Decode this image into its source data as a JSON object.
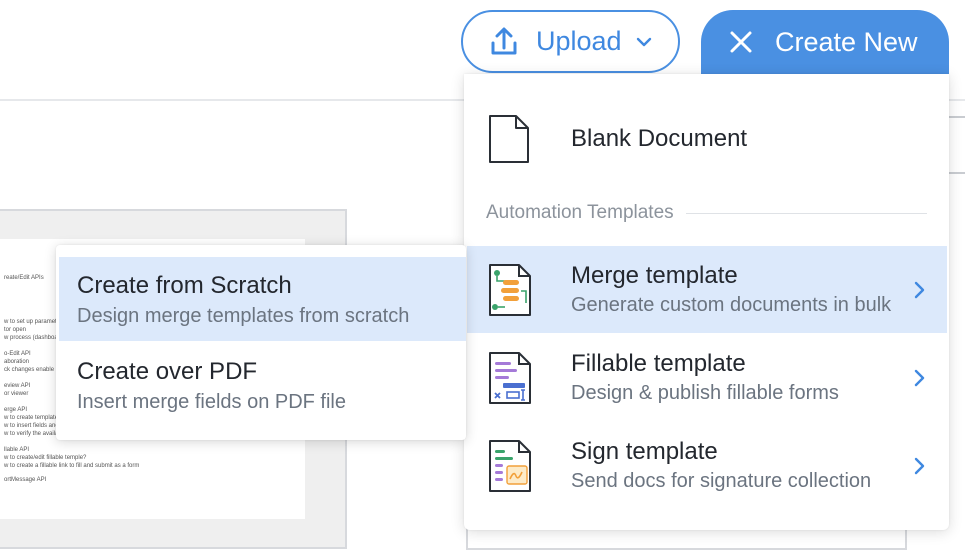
{
  "header": {
    "upload_label": "Upload",
    "create_label": "Create New"
  },
  "document_preview": {
    "lines": [
      "reate/Edit APIs",
      "w to set up parameters",
      "tor open",
      "w process (dashboard)",
      "o-Edit API",
      "aboration",
      "ck changes enable",
      "eview API",
      "or viewer",
      "erge API",
      "w to create template?",
      "w to insert fields and m",
      "w to verify the available",
      "llable API",
      "w to create/edit fillable temple?",
      "w to create a fillable link to fill and submit as a form",
      "ortMessage API"
    ]
  },
  "create_menu": {
    "blank_document": "Blank Document",
    "section_label": "Automation Templates",
    "items": [
      {
        "title": "Merge template",
        "subtitle": "Generate custom documents in bulk"
      },
      {
        "title": "Fillable template",
        "subtitle": "Design & publish fillable forms"
      },
      {
        "title": "Sign template",
        "subtitle": "Send docs for signature collection"
      }
    ]
  },
  "merge_submenu": {
    "items": [
      {
        "title": "Create from Scratch",
        "subtitle": "Design merge templates from scratch"
      },
      {
        "title": "Create over PDF",
        "subtitle": "Insert merge fields on PDF file"
      }
    ]
  },
  "colors": {
    "accent": "#4a90e2",
    "active_bg": "#dce9fb",
    "icon_green": "#3aa36b",
    "icon_orange": "#f2a03a",
    "icon_purple": "#a57ad8",
    "icon_blue": "#4a6fd0"
  }
}
